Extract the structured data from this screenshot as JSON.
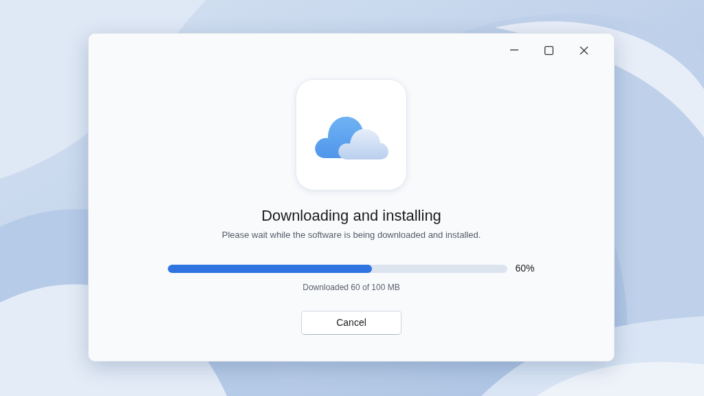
{
  "dialog": {
    "title": "Downloading and installing",
    "message": "Please wait while the software is being downloaded and installed.",
    "progress": {
      "level": 0.6,
      "reading": "60%"
    },
    "detail": "Downloaded 60 of 100 MB",
    "buttons": [
      "Cancel"
    ]
  }
}
